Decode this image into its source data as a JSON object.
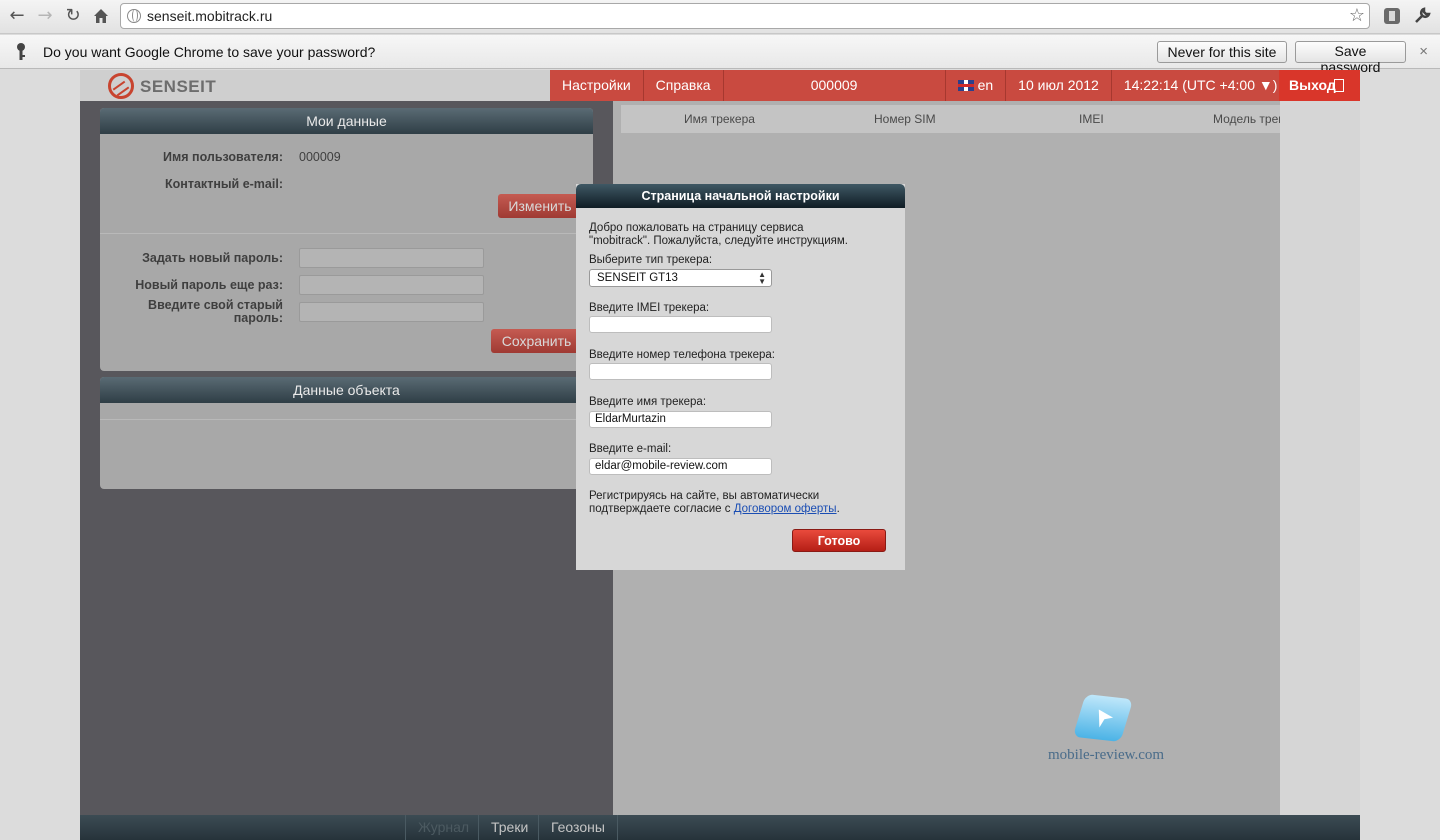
{
  "browser": {
    "url": "senseit.mobitrack.ru",
    "infobar": {
      "message": "Do you want Google Chrome to save your password?",
      "never_label": "Never for this site",
      "save_label": "Save password",
      "close_glyph": "×"
    }
  },
  "header": {
    "logo_text": "SENSEIT",
    "menu": {
      "settings": "Настройки",
      "help": "Справка",
      "account_id": "000009",
      "language": "en",
      "date": "10 июл 2012",
      "time": "14:22:14 (UTC +4:00 ▼)",
      "exit": "Выход"
    }
  },
  "my_data": {
    "title": "Мои данные",
    "username_label": "Имя пользователя:",
    "username_value": "000009",
    "email_label": "Контактный e-mail:",
    "change_button": "Изменить",
    "new_password_label": "Задать новый пароль:",
    "repeat_password_label": "Новый пароль еще раз:",
    "old_password_label": "Введите свой старый пароль:",
    "save_button": "Сохранить"
  },
  "object_data": {
    "title": "Данные объекта"
  },
  "tracker_table": {
    "columns": [
      "Имя трекера",
      "Номер SIM",
      "IMEI",
      "Модель трекера"
    ]
  },
  "footer_tabs": [
    "Журнал",
    "Треки",
    "Геозоны"
  ],
  "watermark": "mobile-review.com",
  "modal": {
    "title": "Страница начальной настройки",
    "intro_line1": "Добро пожаловать на страницу сервиса",
    "intro_line2": "\"mobitrack\". Пожалуйста, следуйте инструкциям.",
    "tracker_type_label": "Выберите тип трекера:",
    "tracker_type_value": "SENSEIT GT13",
    "imei_label": "Введите IMEI трекера:",
    "imei_value": "",
    "phone_label": "Введите номер телефона трекера:",
    "phone_value": "",
    "name_label": "Введите имя трекера:",
    "name_value": "EldarMurtazin",
    "email_label": "Введите e-mail:",
    "email_value": "eldar@mobile-review.com",
    "terms_line1": "Регистрируясь на сайте, вы автоматически",
    "terms_line2_prefix": "подтверждаете согласие с ",
    "terms_link": "Договором оферты",
    "terms_suffix": ".",
    "done_button": "Готово"
  }
}
